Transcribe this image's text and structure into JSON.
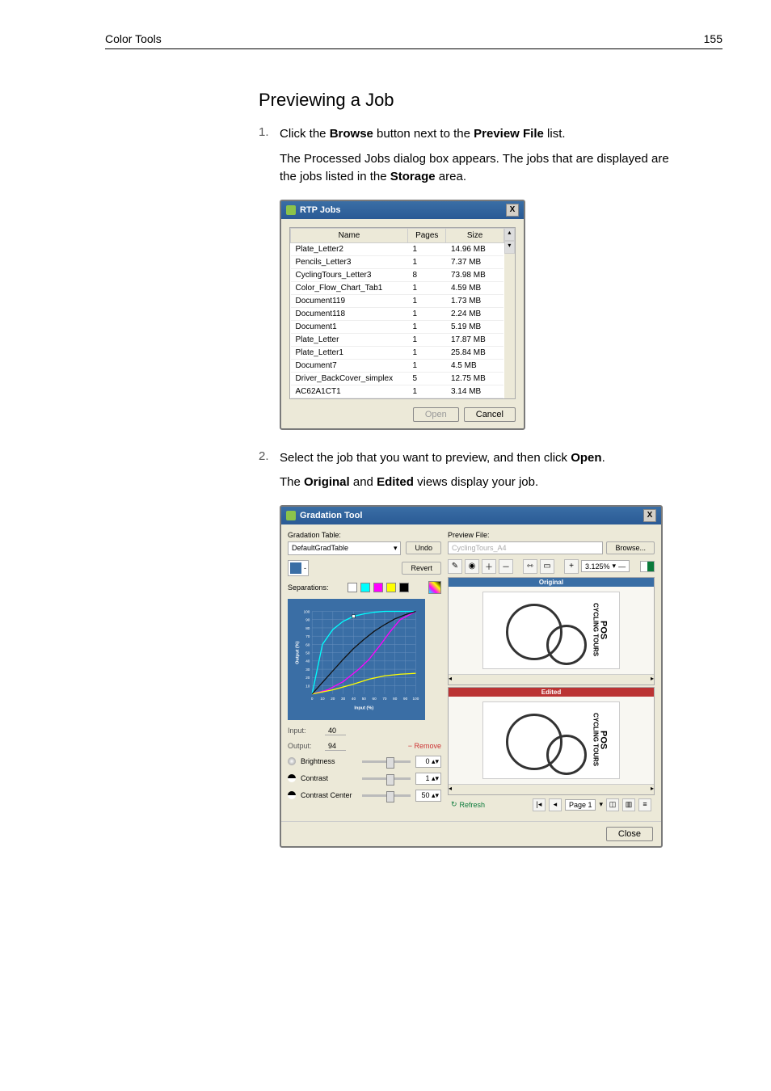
{
  "page_header": {
    "left": "Color Tools",
    "right": "155"
  },
  "section_title": "Previewing a Job",
  "step1": {
    "num": "1.",
    "pre": "Click the ",
    "bold1": "Browse",
    "mid": " button next to the ",
    "bold2": "Preview File",
    "post": " list.",
    "sub_pre": "The Processed Jobs dialog box appears. The jobs that are displayed are the jobs listed in the ",
    "sub_bold": "Storage",
    "sub_post": " area."
  },
  "dlg1": {
    "title": "RTP Jobs",
    "close": "X",
    "col_name": "Name",
    "col_pages": "Pages",
    "col_size": "Size",
    "rows": [
      {
        "name": "Plate_Letter2",
        "pages": "1",
        "size": "14.96 MB"
      },
      {
        "name": "Pencils_Letter3",
        "pages": "1",
        "size": "7.37 MB"
      },
      {
        "name": "CyclingTours_Letter3",
        "pages": "8",
        "size": "73.98 MB"
      },
      {
        "name": "Color_Flow_Chart_Tab1",
        "pages": "1",
        "size": "4.59 MB"
      },
      {
        "name": "Document119",
        "pages": "1",
        "size": "1.73 MB"
      },
      {
        "name": "Document118",
        "pages": "1",
        "size": "2.24 MB"
      },
      {
        "name": "Document1",
        "pages": "1",
        "size": "5.19 MB"
      },
      {
        "name": "Plate_Letter",
        "pages": "1",
        "size": "17.87 MB"
      },
      {
        "name": "Plate_Letter1",
        "pages": "1",
        "size": "25.84 MB"
      },
      {
        "name": "Document7",
        "pages": "1",
        "size": "4.5 MB"
      },
      {
        "name": "Driver_BackCover_simplex",
        "pages": "5",
        "size": "12.75 MB"
      },
      {
        "name": "AC62A1CT1",
        "pages": "1",
        "size": "3.14 MB"
      }
    ],
    "open": "Open",
    "cancel": "Cancel"
  },
  "step2": {
    "num": "2.",
    "pre": "Select the job that you want to preview, and then click ",
    "bold": "Open",
    "post": ".",
    "sub_pre": "The ",
    "sub_b1": "Original",
    "sub_mid": " and ",
    "sub_b2": "Edited",
    "sub_post": " views display your job."
  },
  "dlg2": {
    "title": "Gradation Tool",
    "close": "X",
    "grad_table_label": "Gradation Table:",
    "grad_table_value": "DefaultGradTable",
    "undo": "Undo",
    "revert": "Revert",
    "save_minus": "-",
    "separations": "Separations:",
    "input_label": "Input:",
    "input_value": "40",
    "output_label": "Output:",
    "output_value": "94",
    "remove": "Remove",
    "brightness": "Brightness",
    "brightness_val": "0",
    "contrast": "Contrast",
    "contrast_val": "1",
    "contrast_center": "Contrast Center",
    "contrast_center_val": "50",
    "preview_file_label": "Preview File:",
    "preview_file_value": "CyclingTours_A4",
    "browse": "Browse...",
    "zoom": "3.125%",
    "original": "Original",
    "edited": "Edited",
    "thumb_brand": "POS",
    "thumb_sub": "CYCLING TOURS",
    "refresh": "Refresh",
    "page_label": "Page 1",
    "close_btn": "Close"
  },
  "chart_data": {
    "type": "line",
    "title": "",
    "xlabel": "Input (%)",
    "ylabel": "Output (%)",
    "xlim": [
      0,
      100
    ],
    "ylim": [
      0,
      100
    ],
    "x_ticks": [
      0,
      10,
      20,
      30,
      40,
      50,
      60,
      70,
      80,
      90,
      100
    ],
    "y_ticks": [
      10,
      20,
      30,
      40,
      50,
      60,
      70,
      80,
      90,
      100
    ],
    "series": [
      {
        "name": "Cyan",
        "color": "#00ffff",
        "values": [
          [
            0,
            0
          ],
          [
            10,
            60
          ],
          [
            20,
            78
          ],
          [
            30,
            88
          ],
          [
            40,
            94
          ],
          [
            50,
            97
          ],
          [
            60,
            99
          ],
          [
            70,
            100
          ],
          [
            80,
            100
          ],
          [
            90,
            100
          ],
          [
            100,
            100
          ]
        ]
      },
      {
        "name": "Magenta",
        "color": "#ff00ff",
        "values": [
          [
            0,
            0
          ],
          [
            15,
            5
          ],
          [
            30,
            15
          ],
          [
            45,
            30
          ],
          [
            55,
            42
          ],
          [
            65,
            58
          ],
          [
            75,
            75
          ],
          [
            85,
            90
          ],
          [
            100,
            100
          ]
        ]
      },
      {
        "name": "Yellow",
        "color": "#ffff00",
        "values": [
          [
            0,
            0
          ],
          [
            20,
            5
          ],
          [
            40,
            12
          ],
          [
            55,
            18
          ],
          [
            70,
            22
          ],
          [
            85,
            24
          ],
          [
            100,
            25
          ]
        ]
      },
      {
        "name": "Black",
        "color": "#111111",
        "values": [
          [
            0,
            0
          ],
          [
            10,
            14
          ],
          [
            20,
            28
          ],
          [
            30,
            42
          ],
          [
            40,
            55
          ],
          [
            50,
            66
          ],
          [
            60,
            76
          ],
          [
            70,
            84
          ],
          [
            80,
            91
          ],
          [
            90,
            96
          ],
          [
            100,
            100
          ]
        ]
      }
    ],
    "marker": {
      "x": 40,
      "y": 94
    }
  }
}
